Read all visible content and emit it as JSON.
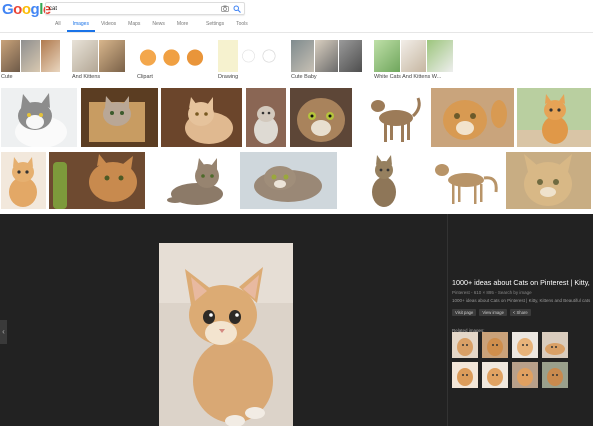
{
  "header": {
    "logo_letters": [
      "G",
      "o",
      "o",
      "g",
      "l",
      "e"
    ],
    "search_value": "cat",
    "tabs": [
      {
        "label": "All",
        "active": false
      },
      {
        "label": "Images",
        "active": true
      },
      {
        "label": "Videos",
        "active": false
      },
      {
        "label": "Maps",
        "active": false
      },
      {
        "label": "News",
        "active": false
      },
      {
        "label": "More",
        "active": false
      }
    ],
    "right_tabs": [
      {
        "label": "Settings"
      },
      {
        "label": "Tools"
      }
    ]
  },
  "chips": [
    {
      "label": "Cute"
    },
    {
      "label": "And Kittens"
    },
    {
      "label": "Clipart"
    },
    {
      "label": "Drawing"
    },
    {
      "label": "Cute Baby"
    },
    {
      "label": "White Cats And Kittens W..."
    }
  ],
  "preview": {
    "title": "1000+ ideas about Cats on Pinterest | Kitty,",
    "meta": "Pinterest - 610 × 895 - Search by image",
    "description": "1000+ ideas about Cats on Pinterest | Kitty, Kittens and Beautiful cats",
    "buttons": [
      {
        "label": "Visit page"
      },
      {
        "label": "View image"
      },
      {
        "label": "< Share"
      }
    ],
    "related_label": "Related images:",
    "left_arrow": "‹"
  },
  "colors": {
    "accent": "#1a73e8",
    "panel_bg": "#222222"
  }
}
